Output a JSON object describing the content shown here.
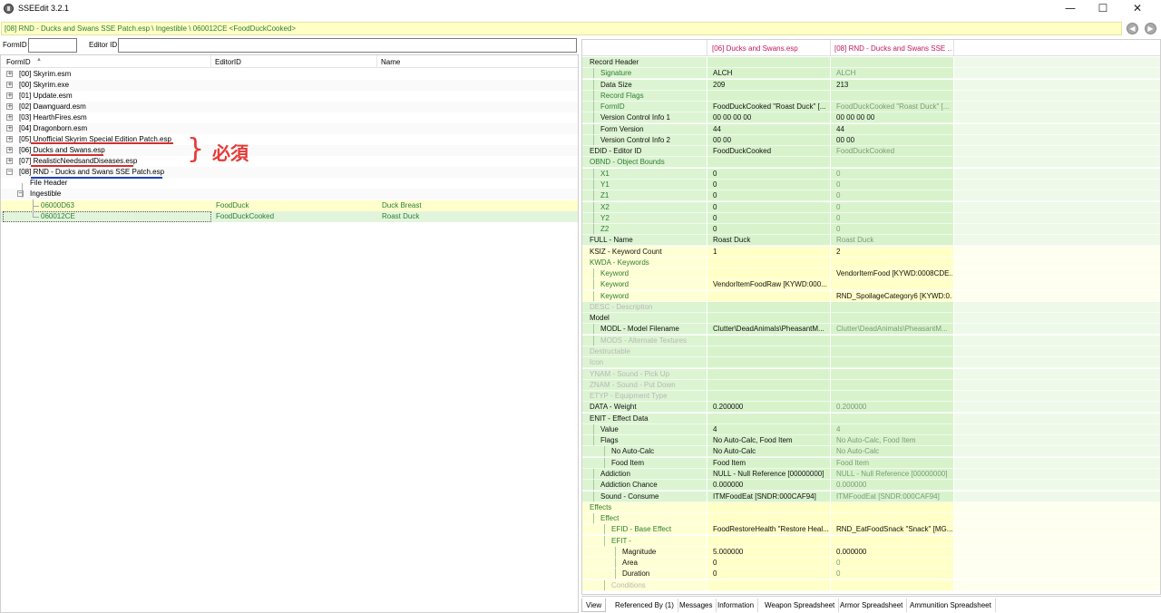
{
  "window": {
    "title": "SSEEdit 3.2.1",
    "minimize": "—",
    "maximize": "☐",
    "close": "✕"
  },
  "path": "[08] RND - Ducks and Swans SSE Patch.esp \\ Ingestible \\ 060012CE <FoodDuckCooked>",
  "nav": {
    "back": "◀",
    "forward": "▶"
  },
  "filter": {
    "formid_label": "FormID",
    "formid_value": "",
    "editorid_label": "Editor ID",
    "editorid_value": ""
  },
  "tree": {
    "columns": [
      "FormID",
      "EditorID",
      "Name"
    ],
    "sort_indicator": "▲",
    "rows": [
      {
        "label": "[00] Skyrim.esm",
        "editorid": "",
        "name": "",
        "expand": "+"
      },
      {
        "label": "[00] Skyrim.exe",
        "editorid": "",
        "name": "",
        "expand": "+"
      },
      {
        "label": "[01] Update.esm",
        "editorid": "",
        "name": "",
        "expand": "+"
      },
      {
        "label": "[02] Dawnguard.esm",
        "editorid": "",
        "name": "",
        "expand": "+"
      },
      {
        "label": "[03] HearthFires.esm",
        "editorid": "",
        "name": "",
        "expand": "+"
      },
      {
        "label": "[04] Dragonborn.esm",
        "editorid": "",
        "name": "",
        "expand": "+"
      },
      {
        "label": "[05] Unofficial Skyrim Special Edition Patch.esp",
        "editorid": "",
        "name": "",
        "expand": "+"
      },
      {
        "label": "[06] Ducks and Swans.esp",
        "editorid": "",
        "name": "",
        "expand": "+"
      },
      {
        "label": "[07] RealisticNeedsandDiseases.esp",
        "editorid": "",
        "name": "",
        "expand": "+"
      },
      {
        "label": "[08] RND - Ducks and Swans SSE Patch.esp",
        "editorid": "",
        "name": "",
        "expand": "−"
      },
      {
        "label": "File Header",
        "editorid": "",
        "name": "",
        "expand": ""
      },
      {
        "label": "Ingestible",
        "editorid": "",
        "name": "",
        "expand": "−"
      },
      {
        "label": "06000D63",
        "editorid": "FoodDuck",
        "name": "Duck Breast",
        "expand": ""
      },
      {
        "label": "060012CE",
        "editorid": "FoodDuckCooked",
        "name": "Roast Duck",
        "expand": ""
      }
    ]
  },
  "annotation": {
    "brace": "}",
    "text": "必須"
  },
  "compare": {
    "headers": [
      "[06] Ducks and Swans.esp",
      "[08] RND - Ducks and Swans SSE ..."
    ],
    "rows": [
      {
        "name": "Record Header",
        "v1": "",
        "v2": ""
      },
      {
        "name": "Signature",
        "v1": "ALCH",
        "v2": "ALCH"
      },
      {
        "name": "Data Size",
        "v1": "209",
        "v2": "213"
      },
      {
        "name": "Record Flags",
        "v1": "",
        "v2": ""
      },
      {
        "name": "FormID",
        "v1": "FoodDuckCooked \"Roast Duck\" [...",
        "v2": "FoodDuckCooked \"Roast Duck\" [..."
      },
      {
        "name": "Version Control Info 1",
        "v1": "00 00 00 00",
        "v2": "00 00 00 00"
      },
      {
        "name": "Form Version",
        "v1": "44",
        "v2": "44"
      },
      {
        "name": "Version Control Info 2",
        "v1": "00 00",
        "v2": "00 00"
      },
      {
        "name": "EDID - Editor ID",
        "v1": "FoodDuckCooked",
        "v2": "FoodDuckCooked"
      },
      {
        "name": "OBND - Object Bounds",
        "v1": "",
        "v2": ""
      },
      {
        "name": "X1",
        "v1": "0",
        "v2": "0"
      },
      {
        "name": "Y1",
        "v1": "0",
        "v2": "0"
      },
      {
        "name": "Z1",
        "v1": "0",
        "v2": "0"
      },
      {
        "name": "X2",
        "v1": "0",
        "v2": "0"
      },
      {
        "name": "Y2",
        "v1": "0",
        "v2": "0"
      },
      {
        "name": "Z2",
        "v1": "0",
        "v2": "0"
      },
      {
        "name": "FULL - Name",
        "v1": "Roast Duck",
        "v2": "Roast Duck"
      },
      {
        "name": "KSIZ - Keyword Count",
        "v1": "1",
        "v2": "2"
      },
      {
        "name": "KWDA - Keywords",
        "v1": "",
        "v2": ""
      },
      {
        "name": "Keyword",
        "v1": "",
        "v2": "VendorItemFood [KYWD:0008CDE..."
      },
      {
        "name": "Keyword",
        "v1": "VendorItemFoodRaw [KYWD:000...",
        "v2": ""
      },
      {
        "name": "Keyword",
        "v1": "",
        "v2": "RND_SpoilageCategory6 [KYWD:0..."
      },
      {
        "name": "DESC - Description",
        "v1": "",
        "v2": ""
      },
      {
        "name": "Model",
        "v1": "",
        "v2": ""
      },
      {
        "name": "MODL - Model Filename",
        "v1": "Clutter\\DeadAnimals\\PheasantM...",
        "v2": "Clutter\\DeadAnimals\\PheasantM..."
      },
      {
        "name": "MODS - Alternate Textures",
        "v1": "",
        "v2": ""
      },
      {
        "name": "Destructable",
        "v1": "",
        "v2": ""
      },
      {
        "name": "Icon",
        "v1": "",
        "v2": ""
      },
      {
        "name": "YNAM - Sound - Pick Up",
        "v1": "",
        "v2": ""
      },
      {
        "name": "ZNAM - Sound - Put Down",
        "v1": "",
        "v2": ""
      },
      {
        "name": "ETYP - Equipment Type",
        "v1": "",
        "v2": ""
      },
      {
        "name": "DATA - Weight",
        "v1": "0.200000",
        "v2": "0.200000"
      },
      {
        "name": "ENIT - Effect Data",
        "v1": "",
        "v2": ""
      },
      {
        "name": "Value",
        "v1": "4",
        "v2": "4"
      },
      {
        "name": "Flags",
        "v1": "No Auto-Calc, Food Item",
        "v2": "No Auto-Calc, Food Item"
      },
      {
        "name": "No Auto-Calc",
        "v1": "No Auto-Calc",
        "v2": "No Auto-Calc"
      },
      {
        "name": "Food Item",
        "v1": "Food Item",
        "v2": "Food Item"
      },
      {
        "name": "Addiction",
        "v1": "NULL - Null Reference [00000000]",
        "v2": "NULL - Null Reference [00000000]"
      },
      {
        "name": "Addiction Chance",
        "v1": "0.000000",
        "v2": "0.000000"
      },
      {
        "name": "Sound - Consume",
        "v1": "ITMFoodEat [SNDR:000CAF94]",
        "v2": "ITMFoodEat [SNDR:000CAF94]"
      },
      {
        "name": "Effects",
        "v1": "",
        "v2": ""
      },
      {
        "name": "Effect",
        "v1": "",
        "v2": ""
      },
      {
        "name": "EFID - Base Effect",
        "v1": "FoodRestoreHealth \"Restore Heal...",
        "v2": "RND_EatFoodSnack \"Snack\" [MG..."
      },
      {
        "name": "EFIT -",
        "v1": "",
        "v2": ""
      },
      {
        "name": "Magnitude",
        "v1": "5.000000",
        "v2": "0.000000"
      },
      {
        "name": "Area",
        "v1": "0",
        "v2": "0"
      },
      {
        "name": "Duration",
        "v1": "0",
        "v2": "0"
      },
      {
        "name": "Conditions",
        "v1": "",
        "v2": ""
      }
    ]
  },
  "tabs": [
    "View",
    "Referenced By (1)",
    "Messages",
    "Information",
    "Weapon Spreadsheet",
    "Armor Spreadsheet",
    "Ammunition Spreadsheet"
  ],
  "colors": {
    "green_bg": "#d8f3d0",
    "yellow_bg": "#ffffcc",
    "conflict_green": "#2e7d32",
    "conflict_red": "#b71c1c",
    "annotation_red": "#e53935",
    "underline_blue": "#1e3fbf"
  }
}
